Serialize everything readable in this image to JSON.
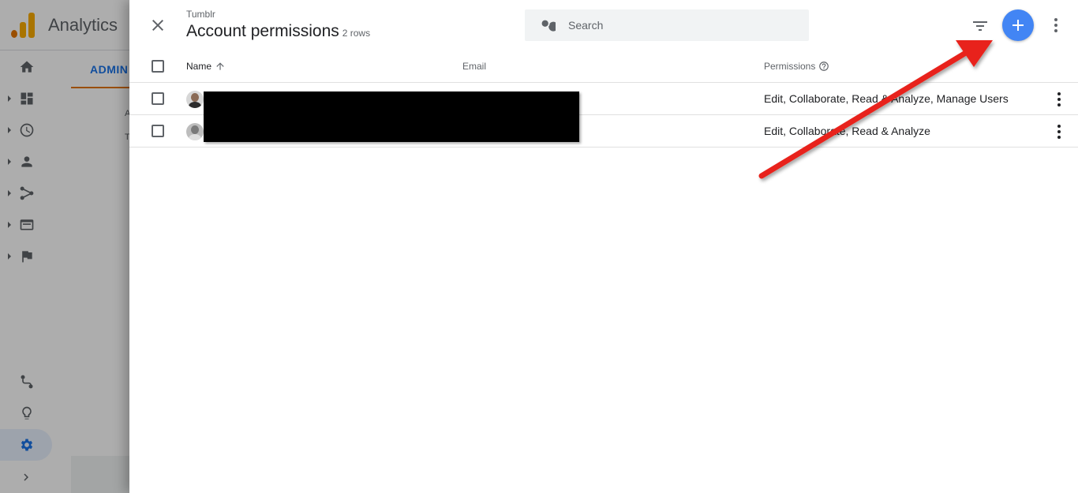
{
  "app": {
    "title": "Analytics",
    "tab_admin": "ADMIN",
    "faint_letters": [
      "A",
      "T"
    ]
  },
  "panel": {
    "subtitle": "Tumblr",
    "title": "Account permissions",
    "row_count": "2 rows",
    "search_placeholder": "Search"
  },
  "table": {
    "columns": {
      "name": "Name",
      "email": "Email",
      "permissions": "Permissions"
    },
    "rows": [
      {
        "name": "",
        "email": "",
        "permissions": "Edit, Collaborate, Read & Analyze, Manage Users"
      },
      {
        "name": "",
        "email": "",
        "permissions": "Edit, Collaborate, Read & Analyze"
      }
    ]
  },
  "colors": {
    "accent": "#1a73e8",
    "fab": "#4285f4",
    "arrow": "#e8231a",
    "admin_underline": "#e37400"
  },
  "icons": {
    "close": "close-icon",
    "search": "search-icon",
    "filter": "filter-icon",
    "add": "add-icon",
    "more": "more-vert-icon",
    "sort": "arrow-upward-icon",
    "help": "help-outline-icon"
  }
}
